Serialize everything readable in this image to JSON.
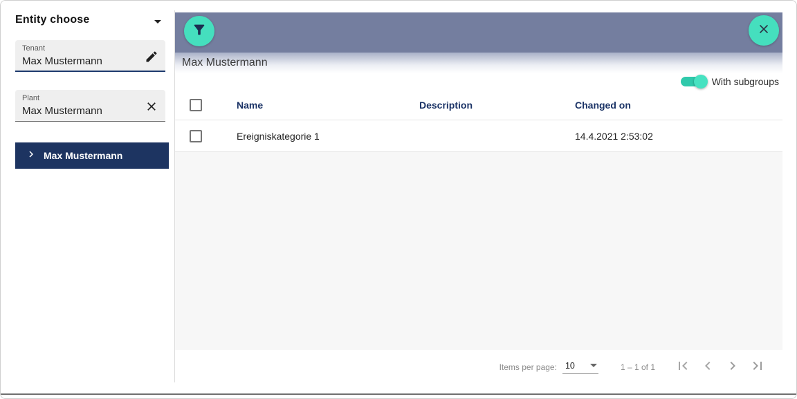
{
  "sidebar": {
    "title": "Entity choose",
    "fields": [
      {
        "label": "Tenant",
        "value": "Max Mustermann",
        "action_icon": "edit-pencil-icon"
      },
      {
        "label": "Plant",
        "value": "Max Mustermann",
        "action_icon": "clear-x-icon"
      }
    ],
    "tree": {
      "selected_item": "Max Mustermann",
      "expander_icon": "chevron-right-icon"
    }
  },
  "main": {
    "toolbar": {
      "filter_icon": "filter-funnel-icon",
      "close_icon": "close-x-icon"
    },
    "title": "Max Mustermann",
    "subgroups_toggle": {
      "label": "With subgroups",
      "state": "on"
    },
    "table": {
      "select_all_checked": false,
      "columns": [
        {
          "label": "Name"
        },
        {
          "label": "Description"
        },
        {
          "label": "Changed on"
        }
      ],
      "rows": [
        {
          "checked": false,
          "name": "Ereigniskategorie 1",
          "description": "",
          "changed_on": "14.4.2021 2:53:02"
        }
      ]
    },
    "paginator": {
      "items_per_page_label": "Items per page:",
      "items_per_page_value": "10",
      "range_label": "1 – 1 of 1",
      "nav_icons": [
        "first-page-icon",
        "previous-page-icon",
        "next-page-icon",
        "last-page-icon"
      ]
    }
  },
  "colors": {
    "accent_teal": "#45dfbe",
    "navy": "#1d3461",
    "appbar_slate": "#747e9f",
    "header_text_navy": "#1b3366"
  }
}
